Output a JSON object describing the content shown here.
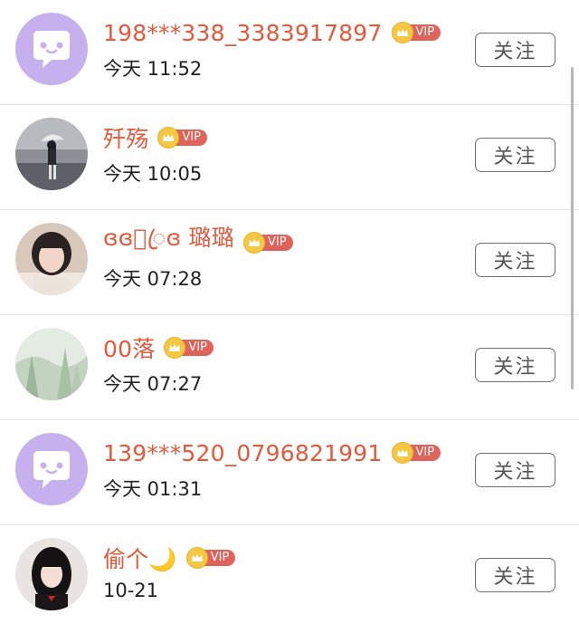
{
  "follow_label": "关注",
  "vip_label": "VIP",
  "users": [
    {
      "name": "198***338_3383917897",
      "time": "今天 11:52",
      "avatar": "default-chat-avatar"
    },
    {
      "name": "歼殇",
      "time": "今天 10:05",
      "avatar": "photo-umbrella-girl"
    },
    {
      "name": "ɞɞ⃞ꦿɞ 璐璐",
      "time": "今天 07:28",
      "avatar": "photo-girl-portrait"
    },
    {
      "name": "00落",
      "time": "今天 07:27",
      "avatar": "photo-green-scenery"
    },
    {
      "name": "139***520_0796821991",
      "time": "今天 01:31",
      "avatar": "default-chat-avatar"
    },
    {
      "name": "偷个🌙",
      "time": "10-21",
      "avatar": "photo-dark-hair-girl"
    }
  ],
  "colors": {
    "name": "#e5583a",
    "vip_tag": "#e0635b",
    "vip_crown": "#f4c842",
    "default_avatar_bg": "#c6b0ee"
  }
}
